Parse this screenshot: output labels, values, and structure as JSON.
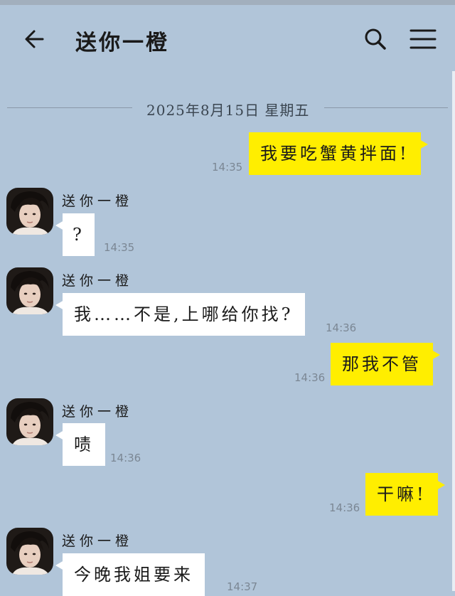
{
  "header": {
    "title": "送你一橙"
  },
  "date_separator": "2025年8月15日 星期五",
  "messages": [
    {
      "text": "我要吃蟹黄拌面!",
      "time": "14:35"
    },
    {
      "sender": "送你一橙",
      "text": "?",
      "time": "14:35"
    },
    {
      "sender": "送你一橙",
      "text": "我……不是,上哪给你找?",
      "time": "14:36"
    },
    {
      "text": "那我不管",
      "time": "14:36"
    },
    {
      "sender": "送你一橙",
      "text": "啧",
      "time": "14:36"
    },
    {
      "text": "干嘛!",
      "time": "14:36"
    },
    {
      "sender": "送你一橙",
      "text": "今晚我姐要来",
      "time": "14:37"
    }
  ],
  "colors": {
    "background": "#b1c5d9",
    "outgoing_bubble": "#ffee00",
    "incoming_bubble": "#ffffff"
  },
  "icons": [
    "back-arrow-icon",
    "search-icon",
    "menu-icon"
  ]
}
